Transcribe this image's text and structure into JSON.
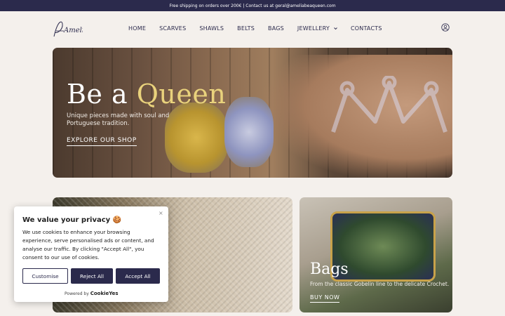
{
  "topbar": {
    "text": "Free shipping on orders over 200€ | Contact us at geral@ameliabeaqueen.com"
  },
  "logo": {
    "text": "Amelia"
  },
  "nav": {
    "items": [
      "HOME",
      "SCARVES",
      "SHAWLS",
      "BELTS",
      "BAGS",
      "JEWELLERY",
      "CONTACTS"
    ]
  },
  "hero": {
    "title_part1": "Be a ",
    "title_part2": "Queen",
    "subtitle": "Unique pieces made with soul and Portuguese tradition.",
    "cta": "EXPLORE OUR SHOP"
  },
  "cards": {
    "bags": {
      "title": "Bags",
      "desc": "From the classic Gobelin line to the delicate Crochet.",
      "cta": "BUY NOW"
    }
  },
  "cookie": {
    "title": "We value your privacy 🍪",
    "text": "We use cookies to enhance your browsing experience, serve personalised ads or content, and analyse our traffic. By clicking \"Accept All\", you consent to our use of cookies.",
    "customise": "Customise",
    "reject": "Reject All",
    "accept": "Accept All",
    "powered_by": "Powered by",
    "brand": "CookieYes",
    "close": "×"
  },
  "colors": {
    "brand": "#2b2a4c",
    "accent": "#e9d27c",
    "background": "#f4f0ec"
  },
  "icons": [
    "user-icon",
    "chevron-down-icon",
    "close-icon",
    "crown-icon"
  ]
}
